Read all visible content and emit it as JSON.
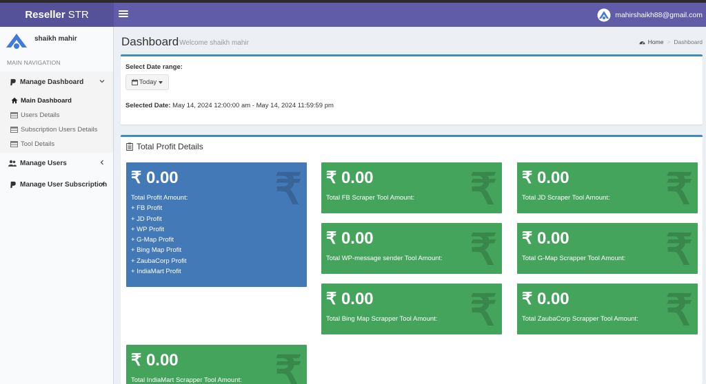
{
  "header": {
    "brand_bold": "Reseller",
    "brand_light": "STR",
    "user_email": "mahirshaikh88@gmail.com"
  },
  "sidebar": {
    "user_name": "shaikh mahir",
    "nav_header": "MAIN NAVIGATION",
    "manage_dashboard": "Manage Dashboard",
    "sub_items": [
      "Main Dashboard",
      "Users Details",
      "Subscription Users Details",
      "Tool Details"
    ],
    "manage_users": "Manage Users",
    "manage_subscription": "Manage User Subscription"
  },
  "page": {
    "title": "Dashboard",
    "subtitle": "Welcome shaikh mahir",
    "breadcrumb_home": "Home",
    "breadcrumb_current": "Dashboard"
  },
  "date_box": {
    "label": "Select Date range:",
    "button": "Today",
    "selected_label": "Selected Date:",
    "selected_value": "May 14, 2024 12:00:00 am - May 14, 2024 11:59:59 pm"
  },
  "profit": {
    "title": "Total Profit Details",
    "currency_symbol": "₹",
    "total": {
      "amount": "₹ 0.00",
      "lines": [
        "Total Profit Amount:",
        "+ FB Profit",
        "+ JD Profit",
        "+ WP Profit",
        "+ G-Map Profit",
        "+ Bing Map Profit",
        "+ ZaubaCorp Profit",
        "+ IndiaMart Profit"
      ]
    },
    "cards": [
      {
        "amount": "₹ 0.00",
        "label": "Total FB Scraper Tool Amount:"
      },
      {
        "amount": "₹ 0.00",
        "label": "Total JD Scraper Tool Amount:"
      },
      {
        "amount": "₹ 0.00",
        "label": "Total WP-message sender Tool Amount:"
      },
      {
        "amount": "₹ 0.00",
        "label": "Total G-Map Scrapper Tool Amount:"
      },
      {
        "amount": "₹ 0.00",
        "label": "Total Bing Map Scrapper Tool Amount:"
      },
      {
        "amount": "₹ 0.00",
        "label": "Total ZaubaCorp Scrapper Tool Amount:"
      },
      {
        "amount": "₹ 0.00",
        "label": "Total IndiaMart Scrapper Tool Amount:"
      }
    ]
  },
  "colors": {
    "header": "#605ca8",
    "brand": "#555299",
    "card_blue": "#4479b7",
    "card_green": "#44a45b",
    "box_accent": "#3c8dbc"
  }
}
